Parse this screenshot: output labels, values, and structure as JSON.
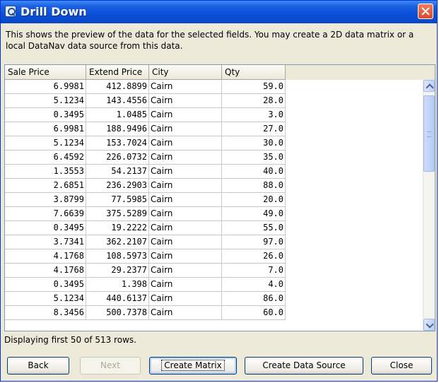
{
  "window": {
    "title": "Drill Down",
    "icon": "datanav-app-icon",
    "close_icon": "close-icon"
  },
  "description": "This shows the preview of the data for the selected fields.  You may create a 2D data matrix or a local DataNav data source from this data.",
  "table": {
    "columns": [
      "Sale Price",
      "Extend Price",
      "City",
      "Qty"
    ],
    "rows": [
      [
        "6.9981",
        "412.8899",
        "Cairn",
        "59.0"
      ],
      [
        "5.1234",
        "143.4556",
        "Cairn",
        "28.0"
      ],
      [
        "0.3495",
        "1.0485",
        "Cairn",
        "3.0"
      ],
      [
        "6.9981",
        "188.9496",
        "Cairn",
        "27.0"
      ],
      [
        "5.1234",
        "153.7024",
        "Cairn",
        "30.0"
      ],
      [
        "6.4592",
        "226.0732",
        "Cairn",
        "35.0"
      ],
      [
        "1.3553",
        "54.2137",
        "Cairn",
        "40.0"
      ],
      [
        "2.6851",
        "236.2903",
        "Cairn",
        "88.0"
      ],
      [
        "3.8799",
        "77.5985",
        "Cairn",
        "20.0"
      ],
      [
        "7.6639",
        "375.5289",
        "Cairn",
        "49.0"
      ],
      [
        "0.3495",
        "19.2222",
        "Cairn",
        "55.0"
      ],
      [
        "3.7341",
        "362.2107",
        "Cairn",
        "97.0"
      ],
      [
        "4.1768",
        "108.5973",
        "Cairn",
        "26.0"
      ],
      [
        "4.1768",
        "29.2377",
        "Cairn",
        "7.0"
      ],
      [
        "0.3495",
        "1.398",
        "Cairn",
        "4.0"
      ],
      [
        "5.1234",
        "440.6137",
        "Cairn",
        "86.0"
      ],
      [
        "8.3456",
        "500.7378",
        "Cairn",
        "60.0"
      ]
    ]
  },
  "status": "Displaying first 50 of 513 rows.",
  "buttons": {
    "back": "Back",
    "next": "Next",
    "create_matrix": "Create Matrix",
    "create_data_source": "Create Data Source",
    "close": "Close"
  },
  "colors": {
    "titlebar": "#0a4fd6",
    "dialog_bg": "#ece9d8",
    "close_button": "#d84a2b"
  }
}
